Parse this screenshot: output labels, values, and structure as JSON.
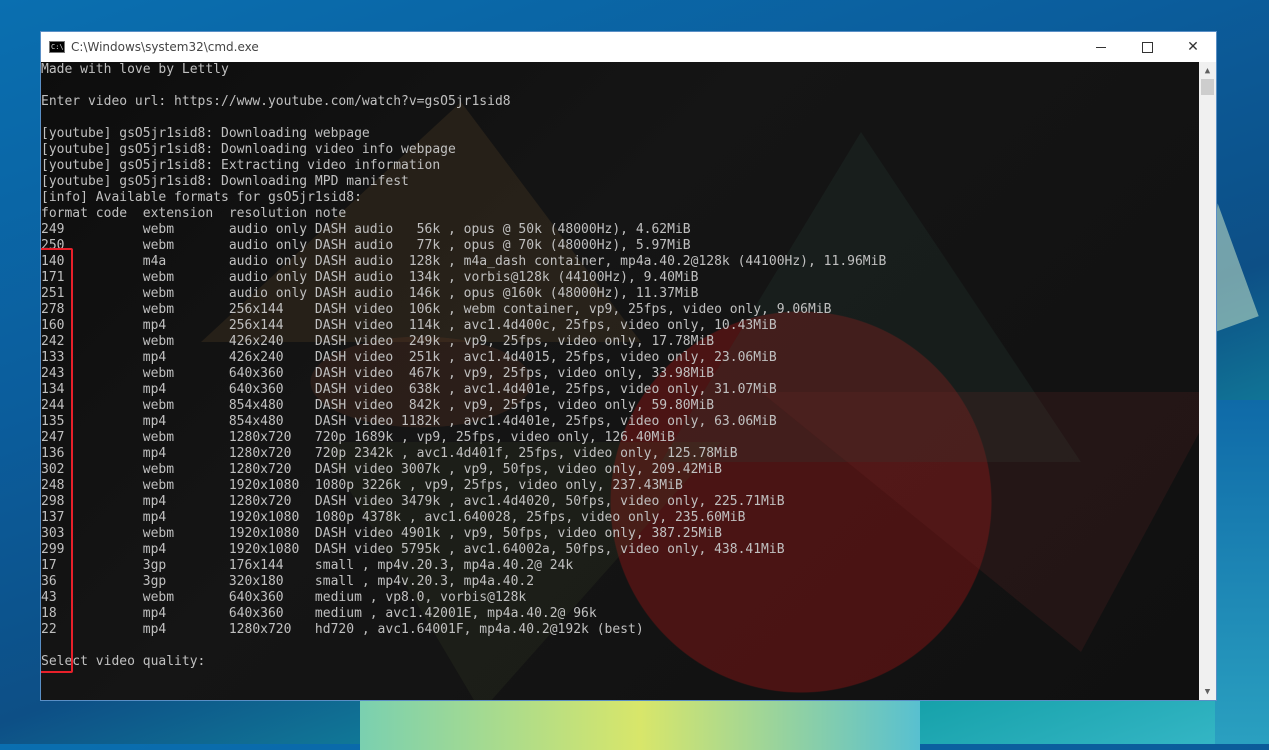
{
  "window": {
    "title": "C:\\Windows\\system32\\cmd.exe",
    "icon_label": "C:\\"
  },
  "console": {
    "lines": [
      "Made with love by Lettly",
      "",
      "Enter video url: https://www.youtube.com/watch?v=gsO5jr1sid8",
      "",
      "[youtube] gsO5jr1sid8: Downloading webpage",
      "[youtube] gsO5jr1sid8: Downloading video info webpage",
      "[youtube] gsO5jr1sid8: Extracting video information",
      "[youtube] gsO5jr1sid8: Downloading MPD manifest",
      "[info] Available formats for gsO5jr1sid8:",
      "format code  extension  resolution note",
      "249          webm       audio only DASH audio   56k , opus @ 50k (48000Hz), 4.62MiB",
      "250          webm       audio only DASH audio   77k , opus @ 70k (48000Hz), 5.97MiB",
      "140          m4a        audio only DASH audio  128k , m4a_dash container, mp4a.40.2@128k (44100Hz), 11.96MiB",
      "171          webm       audio only DASH audio  134k , vorbis@128k (44100Hz), 9.40MiB",
      "251          webm       audio only DASH audio  146k , opus @160k (48000Hz), 11.37MiB",
      "278          webm       256x144    DASH video  106k , webm container, vp9, 25fps, video only, 9.06MiB",
      "160          mp4        256x144    DASH video  114k , avc1.4d400c, 25fps, video only, 10.43MiB",
      "242          webm       426x240    DASH video  249k , vp9, 25fps, video only, 17.78MiB",
      "133          mp4        426x240    DASH video  251k , avc1.4d4015, 25fps, video only, 23.06MiB",
      "243          webm       640x360    DASH video  467k , vp9, 25fps, video only, 33.98MiB",
      "134          mp4        640x360    DASH video  638k , avc1.4d401e, 25fps, video only, 31.07MiB",
      "244          webm       854x480    DASH video  842k , vp9, 25fps, video only, 59.80MiB",
      "135          mp4        854x480    DASH video 1182k , avc1.4d401e, 25fps, video only, 63.06MiB",
      "247          webm       1280x720   720p 1689k , vp9, 25fps, video only, 126.40MiB",
      "136          mp4        1280x720   720p 2342k , avc1.4d401f, 25fps, video only, 125.78MiB",
      "302          webm       1280x720   DASH video 3007k , vp9, 50fps, video only, 209.42MiB",
      "248          webm       1920x1080  1080p 3226k , vp9, 25fps, video only, 237.43MiB",
      "298          mp4        1280x720   DASH video 3479k , avc1.4d4020, 50fps, video only, 225.71MiB",
      "137          mp4        1920x1080  1080p 4378k , avc1.640028, 25fps, video only, 235.60MiB",
      "303          webm       1920x1080  DASH video 4901k , vp9, 50fps, video only, 387.25MiB",
      "299          mp4        1920x1080  DASH video 5795k , avc1.64002a, 50fps, video only, 438.41MiB",
      "17           3gp        176x144    small , mp4v.20.3, mp4a.40.2@ 24k",
      "36           3gp        320x180    small , mp4v.20.3, mp4a.40.2",
      "43           webm       640x360    medium , vp8.0, vorbis@128k",
      "18           mp4        640x360    medium , avc1.42001E, mp4a.40.2@ 96k",
      "22           mp4        1280x720   hd720 , avc1.64001F, mp4a.40.2@192k (best)",
      "",
      "Select video quality:"
    ]
  },
  "colors": {
    "console_text": "#c0c0c0",
    "highlight_border": "#e8202a",
    "titlebar_bg": "#ffffff"
  }
}
